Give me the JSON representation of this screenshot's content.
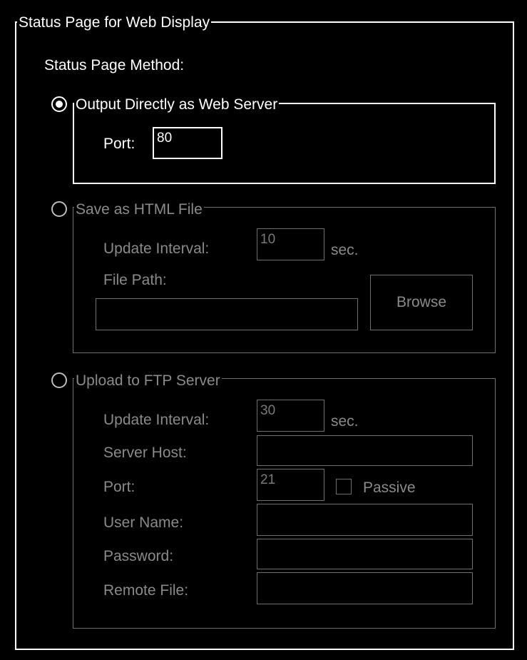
{
  "main_group": {
    "legend": "Status Page for Web Display",
    "method_label": "Status Page Method:"
  },
  "direct_server": {
    "legend": "Output Directly as Web Server",
    "port_label": "Port:",
    "port_value": "80",
    "selected": true
  },
  "html_file": {
    "legend": "Save as HTML File",
    "interval_label": "Update Interval:",
    "interval_value": "10",
    "interval_unit": "sec.",
    "path_label": "File Path:",
    "path_value": "",
    "browse_label": "Browse",
    "selected": false
  },
  "ftp": {
    "legend": "Upload to FTP Server",
    "interval_label": "Update Interval:",
    "interval_value": "30",
    "interval_unit": "sec.",
    "host_label": "Server Host:",
    "host_value": "",
    "port_label": "Port:",
    "port_value": "21",
    "passive_label": "Passive",
    "passive_checked": false,
    "user_label": "User Name:",
    "user_value": "",
    "password_label": "Password:",
    "password_value": "",
    "remote_label": "Remote File:",
    "remote_value": "",
    "selected": false
  }
}
